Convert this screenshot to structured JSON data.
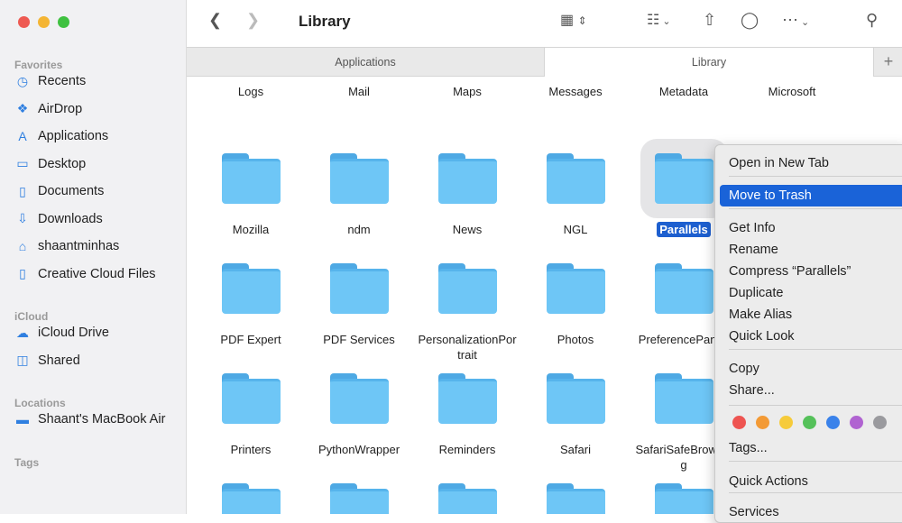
{
  "window": {
    "title": "Library"
  },
  "sidebar": {
    "sections": [
      {
        "label": "Favorites",
        "items": [
          {
            "label": "Recents",
            "icon": "clock-icon"
          },
          {
            "label": "AirDrop",
            "icon": "airdrop-icon"
          },
          {
            "label": "Applications",
            "icon": "applications-icon"
          },
          {
            "label": "Desktop",
            "icon": "desktop-icon"
          },
          {
            "label": "Documents",
            "icon": "document-icon"
          },
          {
            "label": "Downloads",
            "icon": "download-icon"
          },
          {
            "label": "shaantminhas",
            "icon": "home-icon"
          },
          {
            "label": "Creative Cloud Files",
            "icon": "file-icon"
          }
        ]
      },
      {
        "label": "iCloud",
        "items": [
          {
            "label": "iCloud Drive",
            "icon": "cloud-icon"
          },
          {
            "label": "Shared",
            "icon": "shared-folder-icon"
          }
        ]
      },
      {
        "label": "Locations",
        "items": [
          {
            "label": "Shaant's MacBook Air",
            "icon": "laptop-icon"
          }
        ]
      },
      {
        "label": "Tags",
        "items": []
      }
    ]
  },
  "tabs": [
    {
      "label": "Applications",
      "active": false
    },
    {
      "label": "Library",
      "active": true
    }
  ],
  "files": [
    [
      "Logs",
      "Mail",
      "Maps",
      "Messages",
      "Metadata",
      "Microsoft"
    ],
    [
      "Mozilla",
      "ndm",
      "News",
      "NGL",
      "Parallels",
      ""
    ],
    [
      "PDF Expert",
      "PDF Services",
      "PersonalizationPortrait",
      "Photos",
      "PreferencePanes",
      ""
    ],
    [
      "Printers",
      "PythonWrapper",
      "Reminders",
      "Safari",
      "SafariSafeBrowsing",
      ""
    ],
    [
      "",
      "",
      "",
      "",
      "",
      ""
    ]
  ],
  "selected_file": "Parallels",
  "context_menu": {
    "items": [
      "Open in New Tab",
      "Move to Trash",
      "Get Info",
      "Rename",
      "Compress “Parallels”",
      "Duplicate",
      "Make Alias",
      "Quick Look",
      "Copy",
      "Share...",
      "Tags...",
      "Quick Actions",
      "Services"
    ],
    "highlighted": "Move to Trash",
    "tag_colors": [
      "#ee5451",
      "#f39a35",
      "#f6cb3a",
      "#55c15a",
      "#3a82ea",
      "#b063d1",
      "#9a9a9e"
    ]
  }
}
